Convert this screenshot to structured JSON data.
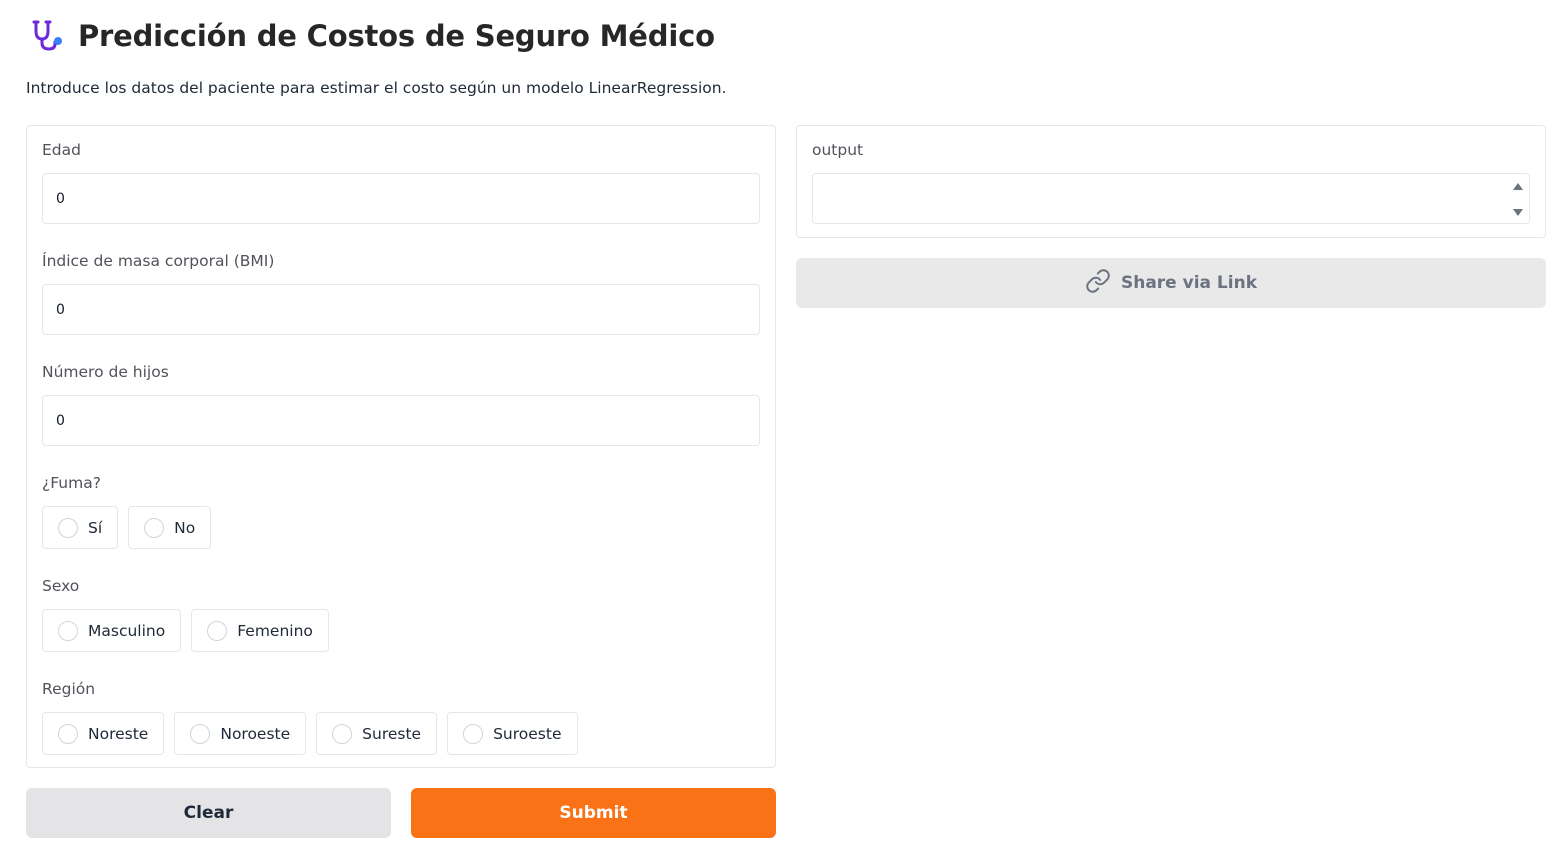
{
  "header": {
    "icon": "stethoscope-icon",
    "title": "Predicción de Costos de Seguro Médico",
    "description": "Introduce los datos del paciente para estimar el costo según un modelo LinearRegression."
  },
  "inputs": {
    "age": {
      "label": "Edad",
      "value": "0"
    },
    "bmi": {
      "label": "Índice de masa corporal (BMI)",
      "value": "0"
    },
    "children": {
      "label": "Número de hijos",
      "value": "0"
    },
    "smoker": {
      "label": "¿Fuma?",
      "options": [
        "Sí",
        "No"
      ]
    },
    "sex": {
      "label": "Sexo",
      "options": [
        "Masculino",
        "Femenino"
      ]
    },
    "region": {
      "label": "Región",
      "options": [
        "Noreste",
        "Noroeste",
        "Sureste",
        "Suroeste"
      ]
    }
  },
  "output": {
    "label": "output",
    "value": ""
  },
  "buttons": {
    "share": "Share via Link",
    "clear": "Clear",
    "submit": "Submit"
  },
  "colors": {
    "accent": "#f97316",
    "icon_primary": "#6d28d9",
    "icon_secondary": "#3b82f6"
  }
}
